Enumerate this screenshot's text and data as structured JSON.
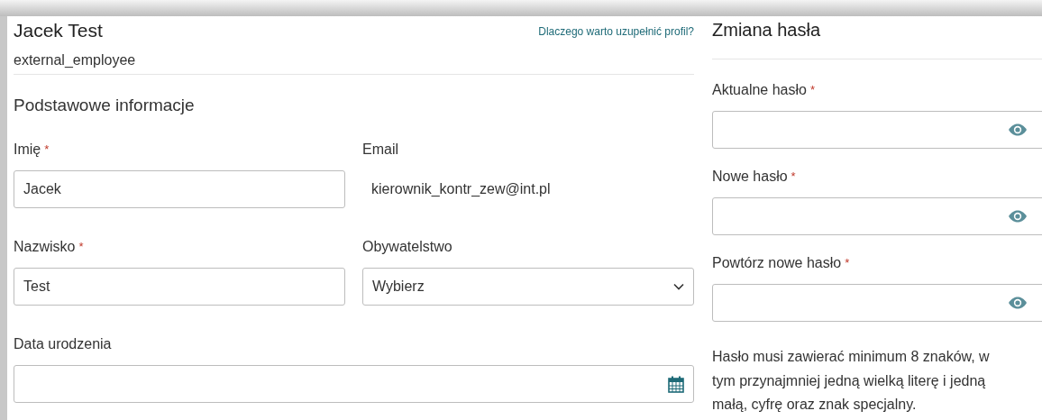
{
  "profile": {
    "name": "Jacek Test",
    "role": "external_employee",
    "help_link": "Dlaczego warto uzupełnić profil?",
    "section_title": "Podstawowe informacje",
    "fields": [
      {
        "kind": "text",
        "label": "Imię",
        "required_mark": "*",
        "value": "Jacek"
      },
      {
        "kind": "static",
        "label": "Email",
        "value": "kierownik_kontr_zew@int.pl"
      },
      {
        "kind": "text",
        "label": "Nazwisko",
        "required_mark": "*",
        "value": "Test"
      },
      {
        "kind": "select",
        "label": "Obywatelstwo",
        "value": "Wybierz"
      },
      {
        "kind": "date",
        "label": "Data urodzenia"
      }
    ]
  },
  "password": {
    "title": "Zmiana hasła",
    "fields": [
      {
        "kind": "password",
        "label": "Aktualne hasło",
        "required_mark": "*"
      },
      {
        "kind": "password",
        "label": "Nowe hasło",
        "required_mark": "*"
      },
      {
        "kind": "password",
        "label": "Powtórz nowe hasło",
        "required_mark": "*"
      }
    ],
    "hint": "Hasło musi zawierać minimum 8 znaków, w tym przynajmniej jedną wielką literę i jedną małą, cyfrę oraz znak specjalny."
  }
}
